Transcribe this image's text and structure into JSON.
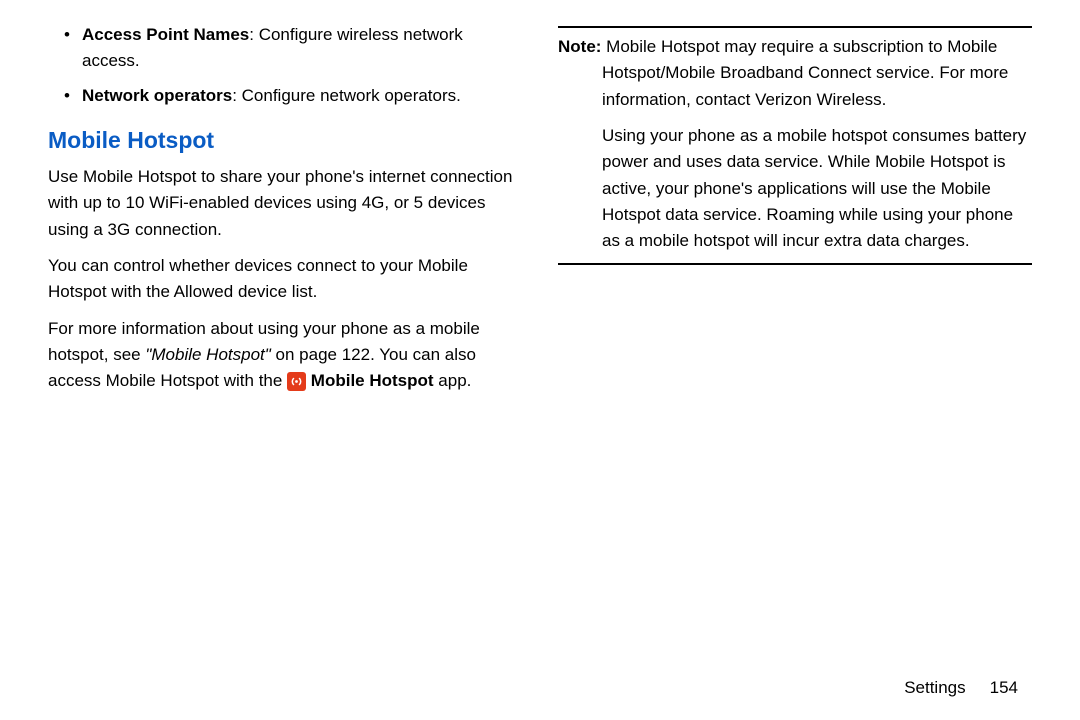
{
  "left": {
    "bullets": [
      {
        "label": "Access Point Names",
        "desc": ": Configure wireless network access."
      },
      {
        "label": "Network operators",
        "desc": ": Configure network operators."
      }
    ],
    "section_title": "Mobile Hotspot",
    "p1": "Use Mobile Hotspot to share your phone's internet connection with up to 10 WiFi-enabled devices using 4G, or 5 devices using a 3G connection.",
    "p2": "You can control whether devices connect to your Mobile Hotspot with the Allowed device list.",
    "p3_a": "For more information about using your phone as a mobile hotspot, see ",
    "p3_link": "\"Mobile Hotspot\"",
    "p3_b": " on page 122. You can also access Mobile Hotspot with the ",
    "app_label": "Mobile Hotspot",
    "p3_c": "  app."
  },
  "right": {
    "note_label": "Note:",
    "note_1": " Mobile Hotspot may require a subscription to Mobile Hotspot/Mobile Broadband Connect service. For more information, contact Verizon Wireless.",
    "note_2": "Using your phone as a mobile hotspot consumes battery power and uses data service. While Mobile Hotspot is active, your phone's applications will use the Mobile Hotspot data service. Roaming while using your phone as a mobile hotspot will incur extra data charges."
  },
  "footer": {
    "section": "Settings",
    "page": "154"
  },
  "icon_glyph": "(•)"
}
